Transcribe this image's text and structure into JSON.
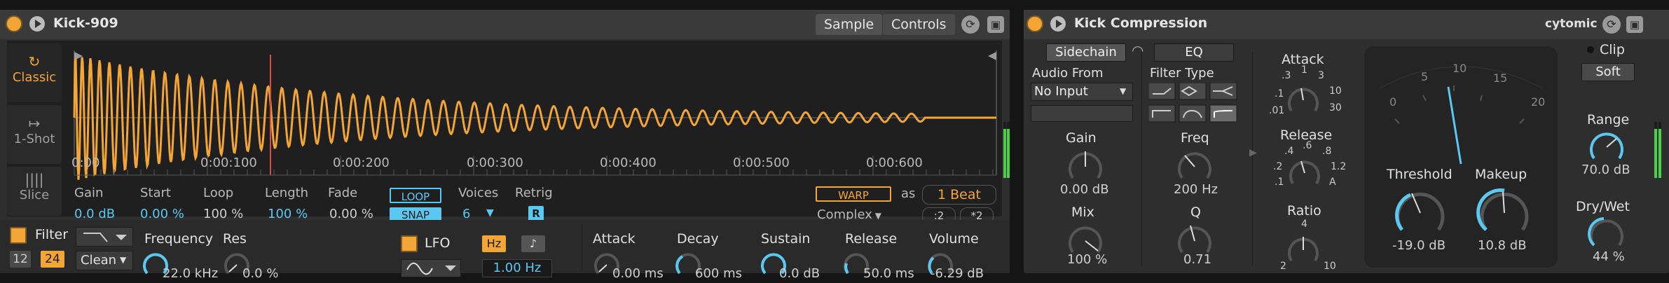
{
  "sampler": {
    "title": "Kick-909",
    "tabs": [
      "Sample",
      "Controls"
    ],
    "modes": [
      "Classic",
      "1-Shot",
      "Slice"
    ],
    "active_mode": "Classic",
    "timeline": [
      "0:00",
      "0:00:100",
      "0:00:200",
      "0:00:300",
      "0:00:400",
      "0:00:500",
      "0:00:600"
    ],
    "params": {
      "gain": {
        "label": "Gain",
        "value": "0.0 dB"
      },
      "start": {
        "label": "Start",
        "value": "0.00 %"
      },
      "loop": {
        "label": "Loop",
        "value": "100 %"
      },
      "length": {
        "label": "Length",
        "value": "100 %"
      },
      "fade": {
        "label": "Fade",
        "value": "0.00 %"
      }
    },
    "loop_btn": "LOOP",
    "snap_btn": "SNAP",
    "voices": {
      "label": "Voices",
      "value": "6"
    },
    "retrig": {
      "label": "Retrig",
      "value": "R"
    },
    "warp_btn": "WARP",
    "as_label": "as",
    "beats": "1 Beat",
    "warp_mode": "Complex",
    "half": ":2",
    "double": "*2",
    "filter": {
      "label": "Filter",
      "btn12": "12",
      "btn24": "24",
      "type": "Clean",
      "freq_label": "Frequency",
      "freq": "22.0 kHz",
      "res_label": "Res",
      "res": "0.0 %"
    },
    "lfo": {
      "label": "LFO",
      "hz_btn": "Hz",
      "note_btn": "♪",
      "rate": "1.00 Hz"
    },
    "envelope": {
      "attack": {
        "label": "Attack",
        "value": "0.00 ms"
      },
      "decay": {
        "label": "Decay",
        "value": "600 ms"
      },
      "sustain": {
        "label": "Sustain",
        "value": "0.0 dB"
      },
      "release": {
        "label": "Release",
        "value": "50.0 ms"
      },
      "volume": {
        "label": "Volume",
        "value": "-6.29 dB"
      }
    }
  },
  "comp": {
    "title": "Kick Compression",
    "brand": "cytomic",
    "sidechain_btn": "Sidechain",
    "eq_btn": "EQ",
    "audio_from_label": "Audio From",
    "audio_from_value": "No Input",
    "filter_type_label": "Filter Type",
    "gain": {
      "label": "Gain",
      "value": "0.00 dB"
    },
    "mix": {
      "label": "Mix",
      "value": "100 %"
    },
    "freq": {
      "label": "Freq",
      "value": "200 Hz"
    },
    "q": {
      "label": "Q",
      "value": "0.71"
    },
    "attack": {
      "label": "Attack",
      "scale": [
        ".3",
        "1",
        "3",
        "10",
        "30",
        ".1",
        ".01"
      ]
    },
    "release": {
      "label": "Release",
      "scale": [
        ".6",
        ".4",
        ".8",
        ".2",
        "1.2",
        ".1",
        "A"
      ]
    },
    "ratio": {
      "label": "Ratio",
      "scale": [
        "4",
        "2",
        "10"
      ]
    },
    "meter_scale": [
      "0",
      "5",
      "10",
      "15",
      "20"
    ],
    "threshold": {
      "label": "Threshold",
      "value": "-19.0 dB"
    },
    "makeup": {
      "label": "Makeup",
      "value": "10.8 dB"
    },
    "clip": {
      "label": "Clip",
      "mode": "Soft"
    },
    "range": {
      "label": "Range",
      "value": "70.0 dB"
    },
    "drywet": {
      "label": "Dry/Wet",
      "value": "44 %"
    }
  },
  "colors": {
    "accent": "#f3a535",
    "blue": "#5bc8f2",
    "panel": "#2e2e2e",
    "display": "#1f1f1f"
  }
}
